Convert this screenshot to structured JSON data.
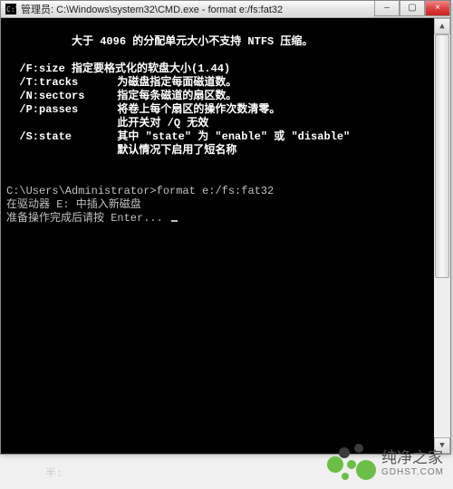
{
  "window": {
    "title": "管理员: C:\\Windows\\system32\\CMD.exe - format  e:/fs:fat32",
    "controls": {
      "minimize": "–",
      "maximize": "▢",
      "close": "×"
    }
  },
  "console": {
    "lines": [
      "",
      "          大于 4096 的分配单元大小不支持 NTFS 压缩。",
      "",
      "  /F:size 指定要格式化的软盘大小(1.44)",
      "  /T:tracks      为磁盘指定每面磁道数。",
      "  /N:sectors     指定每条磁道的扇区数。",
      "  /P:passes      将卷上每个扇区的操作次数清零。",
      "                 此开关对 /Q 无效",
      "  /S:state       其中 \"state\" 为 \"enable\" 或 \"disable\"",
      "                 默认情况下启用了短名称",
      "",
      "",
      "C:\\Users\\Administrator>format e:/fs:fat32",
      "在驱动器 E: 中插入新磁盘",
      "准备操作完成后请按 Enter... "
    ]
  },
  "overlay": {
    "faded_caption": "半:",
    "watermark_cn": "纯净之家",
    "watermark_en": "GDHST.COM"
  },
  "icons": {
    "app_icon": "cmd-icon",
    "min": "minimize-icon",
    "max": "maximize-icon",
    "close": "close-icon",
    "scroll_up": "chevron-up-icon",
    "scroll_down": "chevron-down-icon"
  },
  "colors": {
    "console_bg": "#000000",
    "console_fg": "#c0c0c0",
    "close_btn": "#d33a2f",
    "wm_green": "#6bbf47"
  }
}
